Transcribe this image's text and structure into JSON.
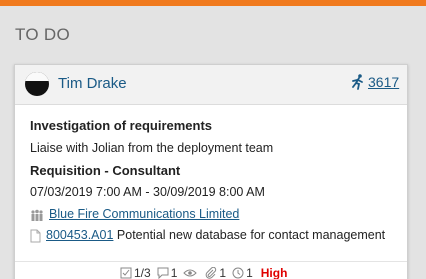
{
  "column": {
    "title": "TO DO"
  },
  "card": {
    "owner": "Tim Drake",
    "item_number": "3617",
    "title": "Investigation of requirements",
    "description": "Liaise with Jolian from the deployment team",
    "requisition": "Requisition - Consultant",
    "date_range": "07/03/2019 7:00 AM - 30/09/2019 8:00 AM",
    "company": "Blue Fire Communications Limited",
    "opportunity_code": "800453.A01",
    "opportunity_desc": "Potential new database for contact management",
    "footer": {
      "checklist": "1/3",
      "comments": "1",
      "attachments": "1",
      "timers": "1",
      "priority": "High"
    }
  },
  "colors": {
    "accent": "#f07a1e",
    "link": "#1a5a86",
    "priority_high": "#e00000"
  },
  "icons": [
    "runner-icon",
    "people-icon",
    "document-icon",
    "checklist-icon",
    "comment-icon",
    "eye-icon",
    "paperclip-icon",
    "clock-icon"
  ]
}
